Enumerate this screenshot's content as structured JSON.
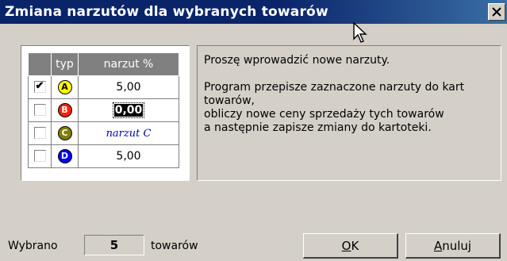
{
  "dialog": {
    "title": "Zmiana narzutów dla wybranych towarów",
    "close_symbol": "✕"
  },
  "grid": {
    "headers": {
      "typ": "typ",
      "narzut": "narzut %"
    },
    "rows": [
      {
        "checked": true,
        "letter": "A",
        "badge_color": "#ffff00",
        "badge_text_color": "#000000",
        "value": "5,00",
        "state": "normal"
      },
      {
        "checked": false,
        "letter": "B",
        "badge_color": "#ff2000",
        "badge_text_color": "#ffffff",
        "value": "0,00",
        "state": "editing"
      },
      {
        "checked": false,
        "letter": "C",
        "badge_color": "#808000",
        "badge_text_color": "#ffffff",
        "value": "narzut C",
        "state": "placeholder"
      },
      {
        "checked": false,
        "letter": "D",
        "badge_color": "#0000ff",
        "badge_text_color": "#ffffff",
        "value": "5,00",
        "state": "normal"
      }
    ],
    "check_mark": "✔"
  },
  "info": {
    "line1": "Proszę wprowadzić nowe narzuty.",
    "line2": "Program przepisze zaznaczone narzuty do kart",
    "line3": "towarów,",
    "line4": "obliczy nowe ceny sprzedaży tych towarów",
    "line5": "a następnie zapisze zmiany do kartoteki."
  },
  "footer": {
    "label_before": "Wybrano",
    "count": "5",
    "label_after": "towarów",
    "ok_mnemonic": "O",
    "ok_rest": "K",
    "cancel_mnemonic": "A",
    "cancel_rest": "nuluj"
  },
  "colors": {
    "titlebar": "#0a246a",
    "face": "#d4d0c8",
    "grid_header": "#808080"
  },
  "icons": {
    "cursor": "arrow-cursor-icon"
  }
}
